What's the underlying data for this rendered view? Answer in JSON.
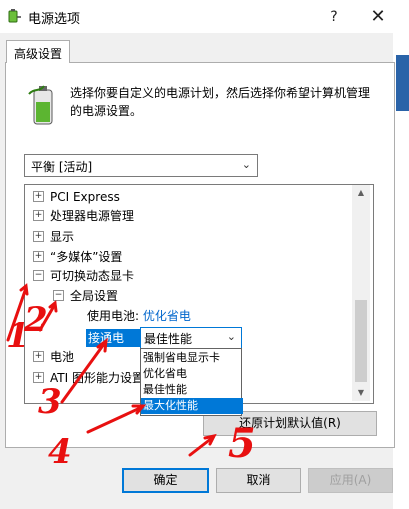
{
  "window": {
    "title": "电源选项",
    "help": "?",
    "close": "✕"
  },
  "tab": {
    "label": "高级设置"
  },
  "description": "选择你要自定义的电源计划，然后选择你希望计算机管理的电源设置。",
  "plan": {
    "selected": "平衡 [活动]"
  },
  "tree": {
    "items": [
      {
        "toggle": "+",
        "label": "PCI Express"
      },
      {
        "toggle": "+",
        "label": "处理器电源管理"
      },
      {
        "toggle": "+",
        "label": "显示"
      },
      {
        "toggle": "+",
        "label": "“多媒体”设置"
      },
      {
        "toggle": "−",
        "label": "可切换动态显卡"
      },
      {
        "toggle": "−",
        "label": "全局设置"
      }
    ],
    "battery_label": "使用电池:",
    "battery_value": "优化省电",
    "plugged_label": "接通电源:",
    "plugged_value": "最佳性能",
    "after_items": [
      {
        "toggle": "+",
        "label": "电池"
      },
      {
        "toggle": "+",
        "label": "ATI 图形能力设置"
      }
    ]
  },
  "dropdown": {
    "options": [
      "强制省电显示卡",
      "优化省电",
      "最佳性能",
      "最大化性能"
    ],
    "highlighted_index": 3
  },
  "buttons": {
    "restore": "还原计划默认值(R)",
    "ok": "确定",
    "cancel": "取消",
    "apply": "应用(A)"
  },
  "annotations": [
    "1",
    "2",
    "3",
    "4",
    "5"
  ],
  "colors": {
    "accent": "#0078d7",
    "annotation": "#e81010",
    "link": "#0066cc"
  }
}
